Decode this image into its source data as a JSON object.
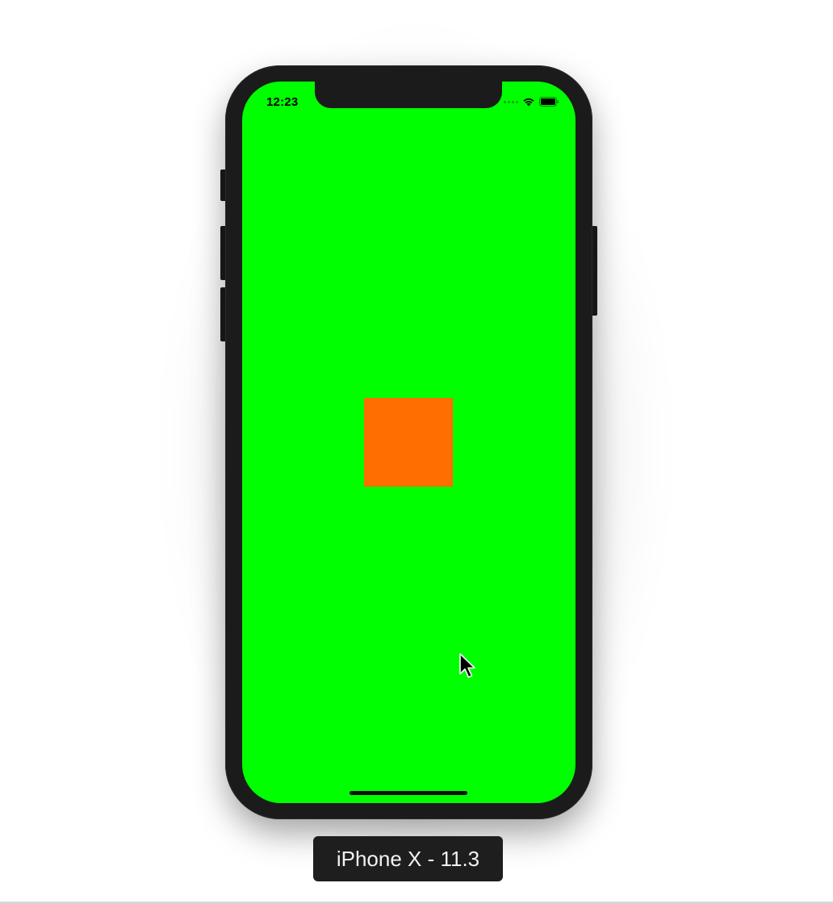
{
  "status_bar": {
    "time": "12:23"
  },
  "device_label": "iPhone X - 11.3",
  "colors": {
    "screen_background": "#00ff00",
    "square": "#ff6e00",
    "device_frame": "#1b1b1b"
  },
  "icons": {
    "cellular": "cellular-signal-icon",
    "wifi": "wifi-icon",
    "battery": "battery-icon",
    "cursor": "mouse-pointer-icon"
  }
}
